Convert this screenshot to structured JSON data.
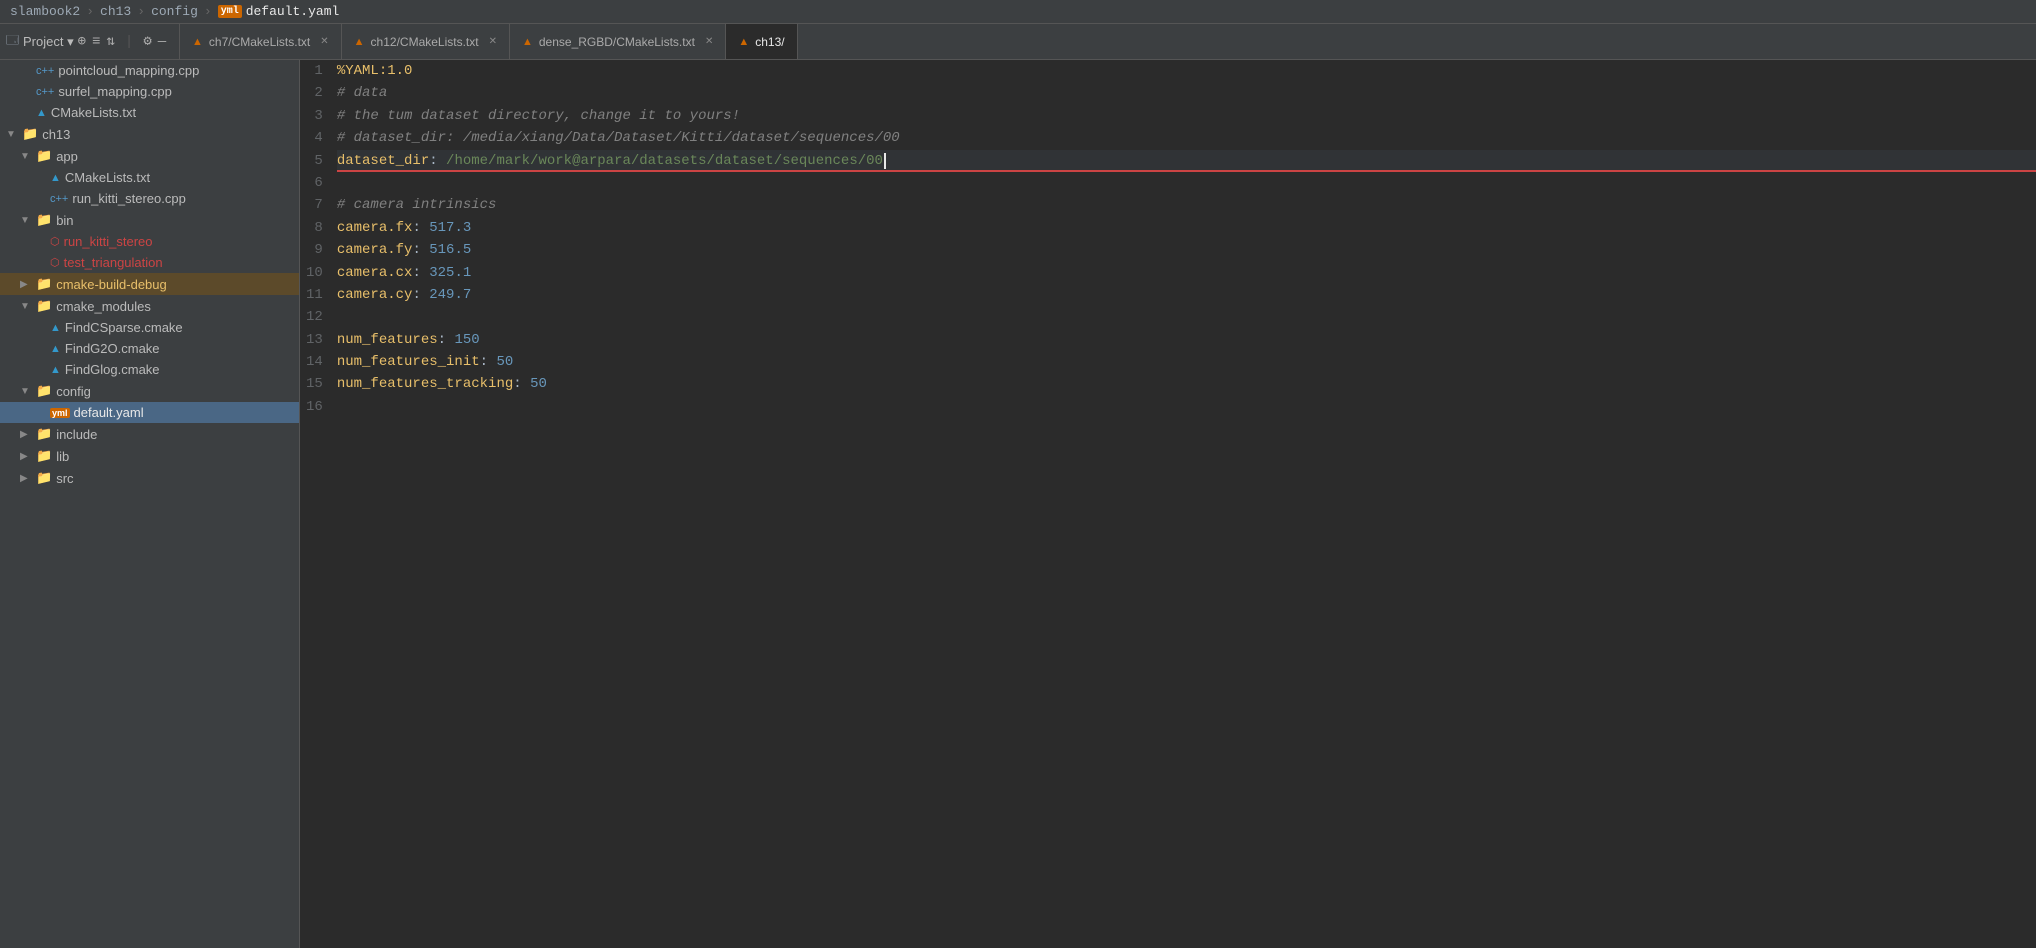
{
  "breadcrumb": {
    "items": [
      "slambook2",
      "ch13",
      "config",
      "default.yaml"
    ],
    "separators": [
      ">",
      ">",
      ">"
    ]
  },
  "tabs": [
    {
      "id": "tab-ch7",
      "label": "ch7/CMakeLists.txt",
      "icon": "cmake",
      "active": false
    },
    {
      "id": "tab-ch12",
      "label": "ch12/CMakeLists.txt",
      "icon": "cmake",
      "active": false
    },
    {
      "id": "tab-dense",
      "label": "dense_RGBD/CMakeLists.txt",
      "icon": "cmake",
      "active": false
    },
    {
      "id": "tab-ch13",
      "label": "ch13/",
      "icon": "cmake",
      "active": true
    }
  ],
  "sidebar": {
    "project_label": "Project",
    "items": [
      {
        "id": "pointcloud",
        "label": "pointcloud_mapping.cpp",
        "type": "cpp",
        "indent": 1
      },
      {
        "id": "surfel",
        "label": "surfel_mapping.cpp",
        "type": "cpp",
        "indent": 1
      },
      {
        "id": "cmakelists-app",
        "label": "CMakeLists.txt",
        "type": "cmake",
        "indent": 1
      },
      {
        "id": "ch13",
        "label": "ch13",
        "type": "folder",
        "indent": 0,
        "expanded": true,
        "arrow": "▼"
      },
      {
        "id": "app",
        "label": "app",
        "type": "folder",
        "indent": 1,
        "expanded": true,
        "arrow": "▼"
      },
      {
        "id": "cmakelists-ch13",
        "label": "CMakeLists.txt",
        "type": "cmake",
        "indent": 2
      },
      {
        "id": "run-kitti",
        "label": "run_kitti_stereo.cpp",
        "type": "cpp",
        "indent": 2
      },
      {
        "id": "bin",
        "label": "bin",
        "type": "folder",
        "indent": 1,
        "expanded": true,
        "arrow": "▼"
      },
      {
        "id": "run-kitti-bin",
        "label": "run_kitti_stereo",
        "type": "bin",
        "indent": 2,
        "color": "red"
      },
      {
        "id": "test-tri",
        "label": "test_triangulation",
        "type": "bin",
        "indent": 2,
        "color": "red"
      },
      {
        "id": "cmake-build-debug",
        "label": "cmake-build-debug",
        "type": "folder",
        "indent": 1,
        "expanded": false,
        "arrow": "▶",
        "highlight": true
      },
      {
        "id": "cmake-modules",
        "label": "cmake_modules",
        "type": "folder",
        "indent": 1,
        "expanded": true,
        "arrow": "▼"
      },
      {
        "id": "findcsparse",
        "label": "FindCSparse.cmake",
        "type": "cmake",
        "indent": 2
      },
      {
        "id": "findg2o",
        "label": "FindG2O.cmake",
        "type": "cmake",
        "indent": 2
      },
      {
        "id": "findglog",
        "label": "FindGlog.cmake",
        "type": "cmake",
        "indent": 2
      },
      {
        "id": "config",
        "label": "config",
        "type": "folder",
        "indent": 1,
        "expanded": true,
        "arrow": "▼"
      },
      {
        "id": "default-yaml",
        "label": "default.yaml",
        "type": "yaml",
        "indent": 2,
        "selected": true
      },
      {
        "id": "include",
        "label": "include",
        "type": "folder",
        "indent": 1,
        "expanded": false,
        "arrow": "▶"
      },
      {
        "id": "lib",
        "label": "lib",
        "type": "folder",
        "indent": 1,
        "expanded": false,
        "arrow": "▶"
      },
      {
        "id": "src",
        "label": "src",
        "type": "folder",
        "indent": 1,
        "expanded": false,
        "arrow": "▶"
      }
    ]
  },
  "editor": {
    "lines": [
      {
        "num": 1,
        "content": "%YAML:1.0",
        "type": "directive"
      },
      {
        "num": 2,
        "content": "# data",
        "type": "comment"
      },
      {
        "num": 3,
        "content": "# the tum dataset directory, change it to yours!",
        "type": "comment"
      },
      {
        "num": 4,
        "content": "# dataset_dir: /media/xiang/Data/Dataset/Kitti/dataset/sequences/00",
        "type": "comment"
      },
      {
        "num": 5,
        "content": "dataset_dir: /home/mark/work@arpara/datasets/dataset/sequences/00",
        "type": "key-value",
        "active": true,
        "underline": true
      },
      {
        "num": 6,
        "content": "",
        "type": "empty"
      },
      {
        "num": 7,
        "content": "# camera intrinsics",
        "type": "comment"
      },
      {
        "num": 8,
        "content": "camera.fx: 517.3",
        "type": "key-value"
      },
      {
        "num": 9,
        "content": "camera.fy: 516.5",
        "type": "key-value"
      },
      {
        "num": 10,
        "content": "camera.cx: 325.1",
        "type": "key-value"
      },
      {
        "num": 11,
        "content": "camera.cy: 249.7",
        "type": "key-value"
      },
      {
        "num": 12,
        "content": "",
        "type": "empty"
      },
      {
        "num": 13,
        "content": "num_features: 150",
        "type": "key-value"
      },
      {
        "num": 14,
        "content": "num_features_init: 50",
        "type": "key-value"
      },
      {
        "num": 15,
        "content": "num_features_tracking: 50",
        "type": "key-value"
      },
      {
        "num": 16,
        "content": "",
        "type": "empty"
      }
    ]
  }
}
